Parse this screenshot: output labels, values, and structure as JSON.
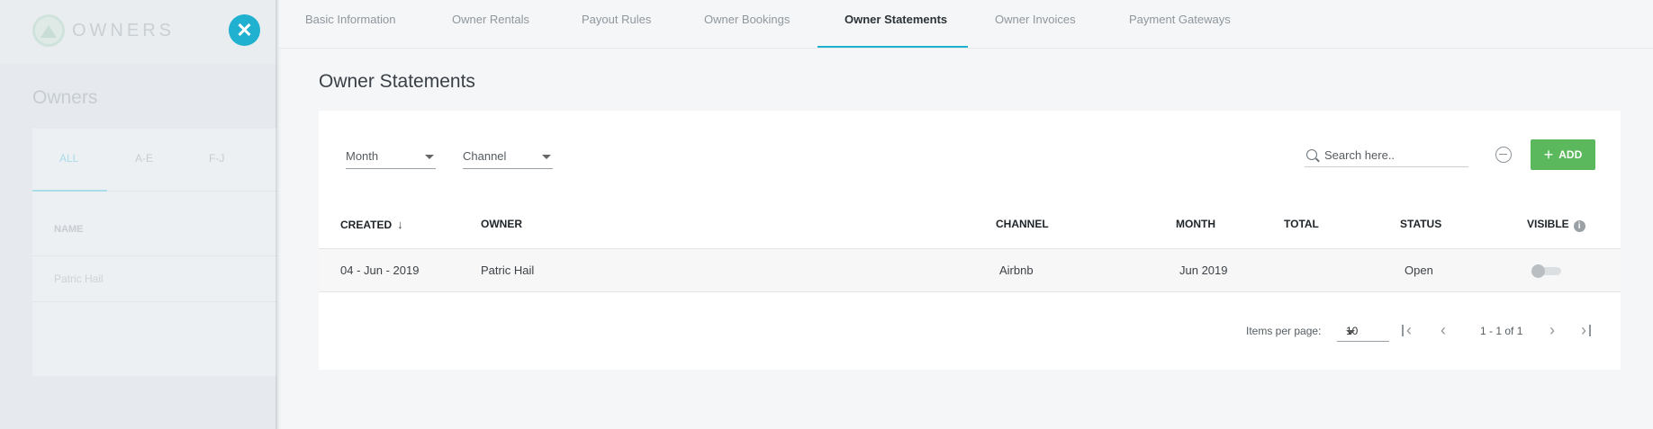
{
  "left_panel": {
    "logo_text": "OWNERS",
    "title": "Owners",
    "tabs": [
      {
        "label": "ALL",
        "active": true
      },
      {
        "label": "A-E",
        "active": false
      },
      {
        "label": "F-J",
        "active": false
      }
    ],
    "column_header": "NAME",
    "rows": [
      "Patric Hail"
    ]
  },
  "tabs": [
    {
      "label": "Basic Information",
      "active": false
    },
    {
      "label": "Owner Rentals",
      "active": false
    },
    {
      "label": "Payout Rules",
      "active": false
    },
    {
      "label": "Owner Bookings",
      "active": false
    },
    {
      "label": "Owner Statements",
      "active": true
    },
    {
      "label": "Owner Invoices",
      "active": false
    },
    {
      "label": "Payment Gateways",
      "active": false
    }
  ],
  "page_title": "Owner Statements",
  "filters": {
    "month_label": "Month",
    "channel_label": "Channel"
  },
  "search": {
    "placeholder": "Search here.."
  },
  "add_button_label": "ADD",
  "table": {
    "headers": {
      "created": "CREATED",
      "owner": "OWNER",
      "channel": "CHANNEL",
      "month": "MONTH",
      "total": "TOTAL",
      "status": "STATUS",
      "visible": "VISIBLE"
    },
    "rows": [
      {
        "created": "04 - Jun - 2019",
        "owner": "Patric Hail",
        "channel": "Airbnb",
        "month": "Jun 2019",
        "total": "",
        "status": "Open",
        "visible": false
      }
    ]
  },
  "paginator": {
    "items_per_page_label": "Items per page:",
    "items_per_page": "10",
    "range_label": "1 - 1 of 1"
  },
  "colors": {
    "accent": "#1fb1cf",
    "add_button": "#5cb85c"
  }
}
